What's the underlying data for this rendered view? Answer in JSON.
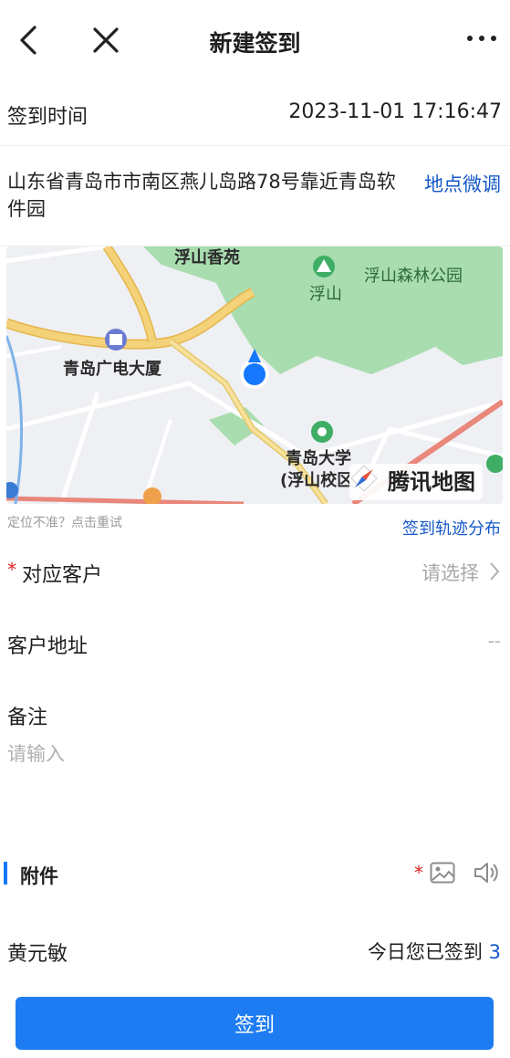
{
  "nav": {
    "title": "新建签到",
    "back_icon": "chevron-left-icon",
    "close_icon": "close-icon",
    "more_icon": "more-icon"
  },
  "checkin_time": {
    "label": "签到时间",
    "value": "2023-11-01 17:16:47"
  },
  "location": {
    "address": "山东省青岛市市南区燕儿岛路78号靠近青岛软件园",
    "adjust_label": "地点微调"
  },
  "map": {
    "labels": {
      "fushan_xiangyuan": "浮山香苑",
      "fushan": "浮山",
      "fushan_park": "浮山森林公园",
      "broadcast_building": "青岛广电大厦",
      "university": "青岛大学",
      "campus": "(浮山校区)"
    },
    "provider": "腾讯地图",
    "colors": {
      "park": "#a9ddb0",
      "road_major": "#f3d27a",
      "marker": "#1677ff"
    }
  },
  "location_tip": "定位不准？点击重试",
  "track_link": "签到轨迹分布",
  "customer": {
    "label": "对应客户",
    "required_mark": "*",
    "placeholder": "请选择"
  },
  "customer_address": {
    "label": "客户地址",
    "value": "--"
  },
  "note": {
    "label": "备注",
    "placeholder": "请输入"
  },
  "attachment": {
    "title": "附件",
    "required_mark": "*",
    "image_icon": "image-icon",
    "audio_icon": "speaker-icon"
  },
  "user": {
    "name": "黄元敏",
    "stat_label": "今日您已签到",
    "stat_count": "3"
  },
  "submit": {
    "label": "签到"
  },
  "colors": {
    "primary": "#1e7cf2",
    "link": "#1558c9",
    "required": "#e02424"
  }
}
